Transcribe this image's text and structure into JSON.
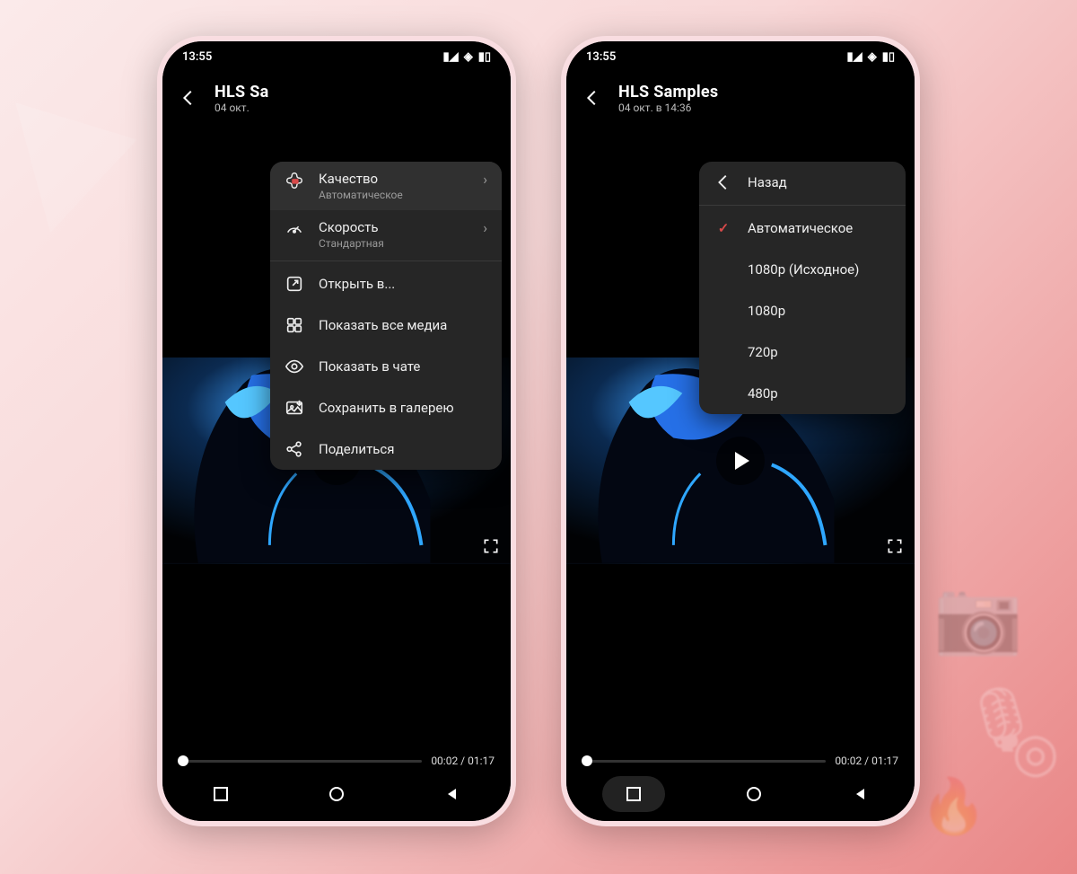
{
  "status": {
    "time": "13:55"
  },
  "header": {
    "title_left_truncated": "HLS Sa",
    "title_right": "HLS Samples",
    "subtitle_left_truncated": "04 окт.",
    "subtitle_right": "04 окт. в 14:36"
  },
  "player": {
    "current_time": "00:02",
    "duration": "01:17",
    "time_sep": " / "
  },
  "menu_main": {
    "quality": {
      "label": "Качество",
      "value": "Автоматическое"
    },
    "speed": {
      "label": "Скорость",
      "value": "Стандартная"
    },
    "open_in": "Открыть в...",
    "show_all_media": "Показать все медиа",
    "show_in_chat": "Показать в чате",
    "save_gallery": "Сохранить в галерею",
    "share": "Поделиться"
  },
  "menu_quality": {
    "back": "Назад",
    "auto": "Автоматическое",
    "q_source": "1080p (Исходное)",
    "q1080": "1080p",
    "q720": "720p",
    "q480": "480p",
    "selected": "auto"
  }
}
